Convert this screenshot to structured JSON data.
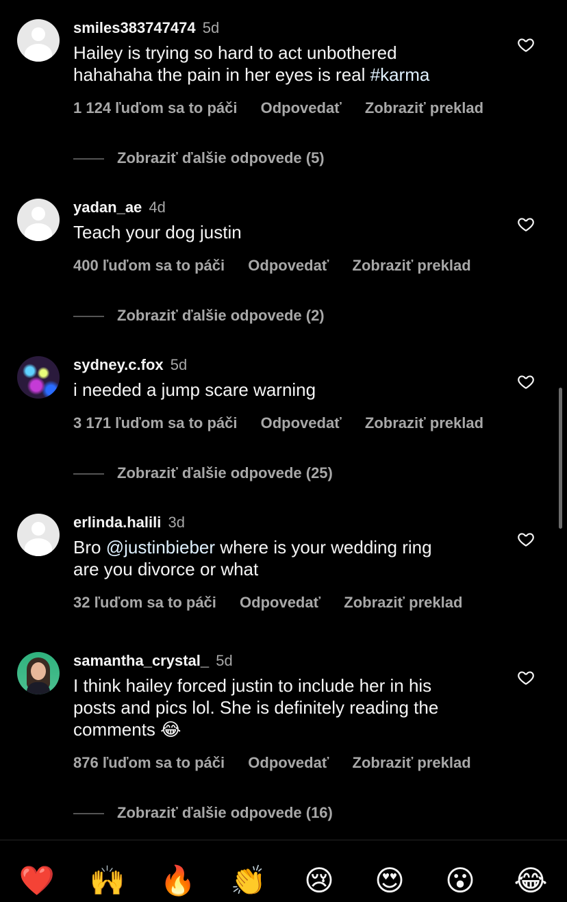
{
  "comments": [
    {
      "username": "smiles383747474",
      "time": "5d",
      "text_lines": [
        "Hailey is trying so hard to act unbothered",
        "hahahaha the pain in her eyes is real "
      ],
      "hashtag": "#karma",
      "likes": "1 124 ľuďom sa to páči",
      "reply": "Odpovedať",
      "translate": "Zobraziť preklad",
      "more_replies": "Zobraziť ďalšie odpovede (5)",
      "avatar": "default"
    },
    {
      "username": "yadan_ae",
      "time": "4d",
      "text": "Teach your dog justin",
      "likes": "400 ľuďom sa to páči",
      "reply": "Odpovedať",
      "translate": "Zobraziť preklad",
      "more_replies": "Zobraziť ďalšie odpovede (2)",
      "avatar": "default"
    },
    {
      "username": "sydney.c.fox",
      "time": "5d",
      "text": "i needed a jump scare warning",
      "likes": "3 171 ľuďom sa to páči",
      "reply": "Odpovedať",
      "translate": "Zobraziť preklad",
      "more_replies": "Zobraziť ďalšie odpovede (25)",
      "avatar": "photo"
    },
    {
      "username": "erlinda.halili",
      "time": "3d",
      "text_prefix": "Bro ",
      "mention": "@justinbieber",
      "text_suffix": " where is your wedding ring",
      "text_line2": "are you divorce or what",
      "likes": "32 ľuďom sa to páči",
      "reply": "Odpovedať",
      "translate": "Zobraziť preklad",
      "avatar": "default"
    },
    {
      "username": "samantha_crystal_",
      "time": "5d",
      "text_lines": [
        "I think hailey forced justin to include her in his",
        "posts and pics lol. She is definitely reading the",
        "comments 😂"
      ],
      "likes": "876 ľuďom sa to páči",
      "reply": "Odpovedať",
      "translate": "Zobraziť preklad",
      "more_replies": "Zobraziť ďalšie odpovede (16)",
      "avatar": "memoji"
    }
  ],
  "icons": {
    "like": "heart-outline-icon"
  },
  "reactions": [
    "❤️",
    "🙌",
    "🔥",
    "👏",
    "😢",
    "😍",
    "😮",
    "😂"
  ],
  "colors": {
    "background": "#000000",
    "text": "#f5f5f5",
    "secondary": "#a8a8a8",
    "mention": "#e0f1ff"
  }
}
